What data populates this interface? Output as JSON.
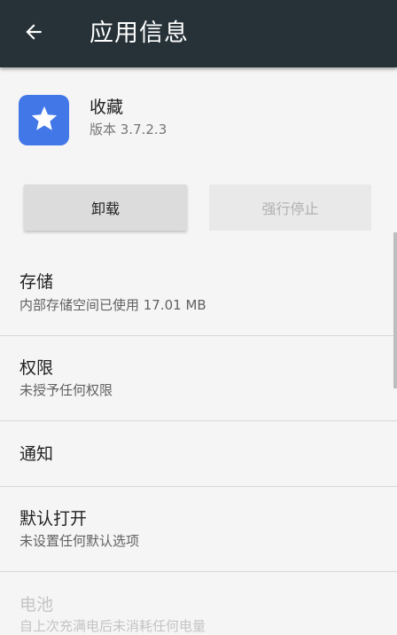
{
  "appbar": {
    "back_icon": "arrow-left-icon",
    "title": "应用信息",
    "color": "#263238"
  },
  "app": {
    "icon": "star-icon",
    "icon_color": "#4277e8",
    "name": "收藏",
    "version": "版本 3.7.2.3"
  },
  "buttons": {
    "uninstall_label": "卸载",
    "force_stop_label": "强行停止"
  },
  "settings": [
    {
      "title": "存储",
      "subtitle": "内部存储空间已使用 17.01 MB"
    },
    {
      "title": "权限",
      "subtitle": "未授予任何权限"
    },
    {
      "title": "通知"
    },
    {
      "title": "默认打开",
      "subtitle": "未设置任何默认选项"
    },
    {
      "title": "电池",
      "subtitle": "自上次充满电后未消耗任何电量"
    }
  ]
}
